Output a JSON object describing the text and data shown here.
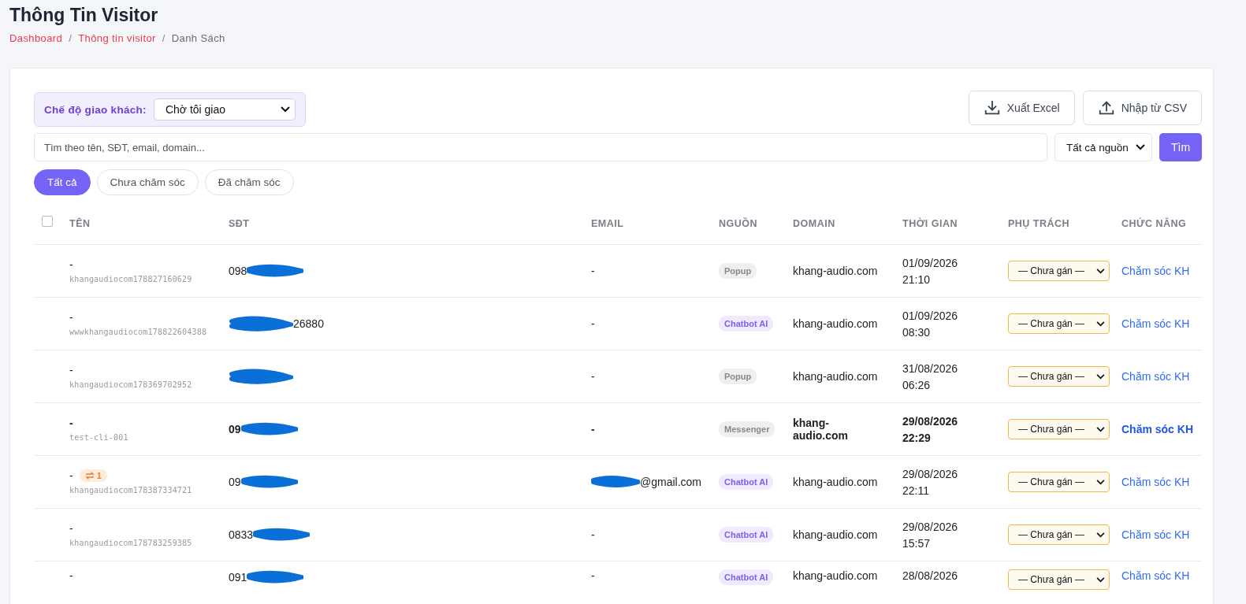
{
  "page": {
    "title": "Thông Tin Visitor",
    "breadcrumb": [
      {
        "label": "Dashboard",
        "link": true
      },
      {
        "label": "Thông tin visitor",
        "link": true,
        "separator": "/"
      },
      {
        "label": "Danh Sách",
        "link": false,
        "separator": "/"
      }
    ]
  },
  "mode": {
    "label": "Chế độ giao khách:",
    "value": "Chờ tôi giao"
  },
  "actions": [
    {
      "label": "Xuất Excel",
      "kind": "download"
    },
    {
      "label": "Nhập từ CSV",
      "kind": "upload"
    }
  ],
  "search": {
    "placeholder": "Tìm theo tên, SĐT, email, domain...",
    "source": "Tất cả nguồn",
    "button": "Tìm"
  },
  "filters": [
    {
      "label": "Tất cả",
      "selected": true
    },
    {
      "label": "Chưa chăm sóc",
      "selected": false
    },
    {
      "label": "Đã chăm sóc",
      "selected": false
    }
  ],
  "table": {
    "select_all": {
      "checked": false
    },
    "columns": [
      "TÊN",
      "SĐT",
      "EMAIL",
      "NGUỒN",
      "DOMAIN",
      "THỜI GIAN",
      "PHỤ TRÁCH",
      "CHỨC NĂNG"
    ],
    "rows": [
      {
        "name": "-",
        "sub": "khangaudiocom178827160629",
        "phone": {
          "text": "098",
          "kind": "masked_after"
        },
        "email": {
          "text": "-"
        },
        "source": {
          "label": "Popup",
          "kind": "grey"
        },
        "domain": "khang-audio.com",
        "time": [
          "01/09/2026",
          "21:10"
        ],
        "assignee": "— Chưa gán —",
        "action": "Chăm sóc KH",
        "bold": false
      },
      {
        "name": "-",
        "sub": "wwwkhangaudiocom178822604388",
        "phone": {
          "text": "26880",
          "kind": "masked_before"
        },
        "email": {
          "text": "-"
        },
        "source": {
          "label": "Chatbot AI",
          "kind": "purple"
        },
        "domain": "khang-audio.com",
        "time": [
          "01/09/2026",
          "08:30"
        ],
        "assignee": "— Chưa gán —",
        "action": "Chăm sóc KH",
        "bold": false
      },
      {
        "name": "-",
        "sub": "khangaudiocom178369702952",
        "phone": {
          "kind": "masked_all"
        },
        "email": {
          "text": "-"
        },
        "source": {
          "label": "Popup",
          "kind": "grey"
        },
        "domain": "khang-audio.com",
        "time": [
          "31/08/2026",
          "06:26"
        ],
        "assignee": "— Chưa gán —",
        "action": "Chăm sóc KH",
        "bold": false
      },
      {
        "name": "-",
        "sub": "test-cli-001",
        "phone": {
          "text": "09",
          "kind": "masked_after"
        },
        "email": {
          "text": "-"
        },
        "source": {
          "label": "Messenger",
          "kind": "grey"
        },
        "domain": "khang-audio.com",
        "time": [
          "29/08/2026",
          "22:29"
        ],
        "assignee": "— Chưa gán —",
        "action": "Chăm sóc KH",
        "bold": true
      },
      {
        "name": "-",
        "badge": "1",
        "sub": "khangaudiocom178387334721",
        "phone": {
          "text": "09",
          "kind": "masked_after"
        },
        "email": {
          "text": "@gmail.com",
          "kind": "masked_before"
        },
        "source": {
          "label": "Chatbot AI",
          "kind": "purple"
        },
        "domain": "khang-audio.com",
        "time": [
          "29/08/2026",
          "22:11"
        ],
        "assignee": "— Chưa gán —",
        "action": "Chăm sóc KH",
        "bold": false
      },
      {
        "name": "-",
        "sub": "khangaudiocom178783259385",
        "phone": {
          "text": "0833",
          "kind": "masked_after"
        },
        "email": {
          "text": "-"
        },
        "source": {
          "label": "Chatbot AI",
          "kind": "purple"
        },
        "domain": "khang-audio.com",
        "time": [
          "29/08/2026",
          "15:57"
        ],
        "assignee": "— Chưa gán —",
        "action": "Chăm sóc KH",
        "bold": false
      },
      {
        "name": "-",
        "phone": {
          "text": "091",
          "kind": "masked_after"
        },
        "email": {
          "text": "-"
        },
        "source": {
          "label": "Chatbot AI",
          "kind": "purple"
        },
        "domain": "khang-audio.com",
        "time": [
          "28/08/2026"
        ],
        "assignee": "— Chưa gán —",
        "action": "Chăm sóc KH",
        "bold": false
      }
    ]
  }
}
